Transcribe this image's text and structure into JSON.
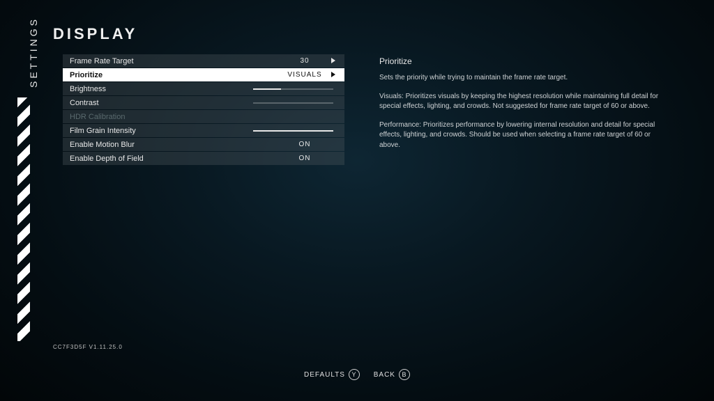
{
  "sidebar": {
    "label": "SETTINGS"
  },
  "page": {
    "title": "DISPLAY",
    "version": "CC7F3D5F V1.11.25.0"
  },
  "options": [
    {
      "label": "Frame Rate Target",
      "value": "30",
      "type": "select"
    },
    {
      "label": "Prioritize",
      "value": "VISUALS",
      "type": "select",
      "selected": true
    },
    {
      "label": "Brightness",
      "type": "slider",
      "fill": 35
    },
    {
      "label": "Contrast",
      "type": "slider",
      "fill": 0
    },
    {
      "label": "HDR Calibration",
      "type": "disabled"
    },
    {
      "label": "Film Grain Intensity",
      "type": "slider",
      "fill": 100
    },
    {
      "label": "Enable Motion Blur",
      "value": "ON",
      "type": "toggle"
    },
    {
      "label": "Enable Depth of Field",
      "value": "ON",
      "type": "toggle"
    }
  ],
  "description": {
    "title": "Prioritize",
    "p1": "Sets the priority while trying to maintain the frame rate target.",
    "p2": "Visuals: Prioritizes visuals by keeping the highest resolution while maintaining full detail for special effects, lighting, and crowds. Not suggested for frame rate target of 60 or above.",
    "p3": "Performance: Prioritizes performance by lowering internal resolution and detail for special effects, lighting, and crowds. Should be used when selecting a frame rate target of 60 or above."
  },
  "footer": {
    "defaults": {
      "label": "DEFAULTS",
      "key": "Y"
    },
    "back": {
      "label": "BACK",
      "key": "B"
    }
  }
}
